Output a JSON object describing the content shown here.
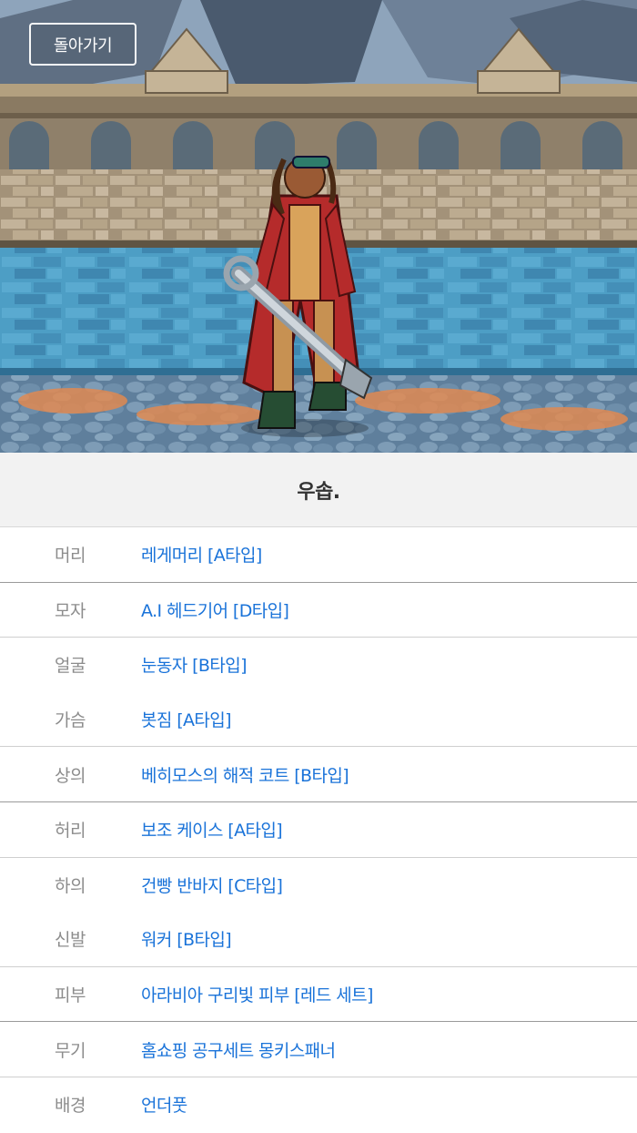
{
  "header": {
    "back_label": "돌아가기"
  },
  "character": {
    "name": "우솝."
  },
  "equipment": [
    {
      "slot": "머리",
      "item": "레게머리 [A타입]"
    },
    {
      "slot": "모자",
      "item": "A.I 헤드기어 [D타입]"
    },
    {
      "slot": "얼굴",
      "item": "눈동자 [B타입]"
    },
    {
      "slot": "가슴",
      "item": "봇짐 [A타입]"
    },
    {
      "slot": "상의",
      "item": "베히모스의 해적 코트 [B타입]"
    },
    {
      "slot": "허리",
      "item": "보조 케이스 [A타입]"
    },
    {
      "slot": "하의",
      "item": "건빵 반바지 [C타입]"
    },
    {
      "slot": "신발",
      "item": "워커 [B타입]"
    },
    {
      "slot": "피부",
      "item": "아라비아 구리빛 피부 [레드 세트]"
    },
    {
      "slot": "무기",
      "item": "홈쇼핑 공구세트 몽키스패너"
    },
    {
      "slot": "배경",
      "item": "언더풋"
    }
  ],
  "colors": {
    "item_link": "#1a73d9",
    "slot_label": "#8c8c8c",
    "title_bg": "#f2f2f2"
  }
}
